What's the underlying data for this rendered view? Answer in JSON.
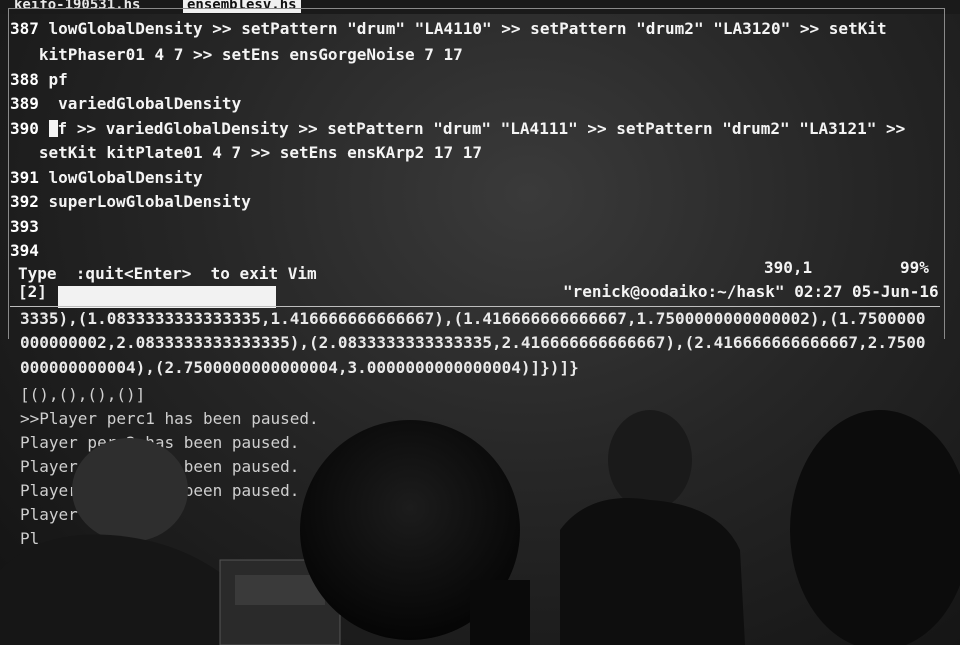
{
  "tabs": [
    {
      "label": "keifo-190531.hs"
    },
    {
      "label": "ensemblesv.hs"
    }
  ],
  "vim": {
    "lines": [
      {
        "num": "387",
        "text": " lowGlobalDensity >> setPattern \"drum\" \"LA4110\" >> setPattern \"drum2\" \"LA3120\" >> setKit"
      },
      {
        "num": "",
        "text": "   kitPhaser01 4 7 >> setEns ensGorgeNoise 7 17"
      },
      {
        "num": "388",
        "text": " pf"
      },
      {
        "num": "389",
        "text": "  variedGlobalDensity"
      },
      {
        "num": "390",
        "text": "f >> variedGlobalDensity >> setPattern \"drum\" \"LA4111\" >> setPattern \"drum2\" \"LA3121\" >>"
      },
      {
        "num": "",
        "text": "   setKit kitPlate01 4 7 >> setEns ensKArp2 17 17"
      },
      {
        "num": "391",
        "text": " lowGlobalDensity"
      },
      {
        "num": "392",
        "text": " superLowGlobalDensity"
      },
      {
        "num": "393",
        "text": ""
      },
      {
        "num": "394",
        "text": ""
      }
    ],
    "message": "Type  :quit<Enter>  to exit Vim",
    "position": "390,1",
    "percent": "99%"
  },
  "tmux": {
    "window": "[2]",
    "right": "\"renick@oodaiko:~/hask\" 02:27 05-Jun-16"
  },
  "ghci": [
    "3335),(1.0833333333333335,1.416666666666667),(1.416666666666667,1.7500000000000002),(1.7500000",
    "000000002,2.0833333333333335),(2.0833333333333335,2.416666666666667),(2.416666666666667,2.7500",
    "000000000004),(2.7500000000000004,3.0000000000000004)]})]}",
    "[(),(),(),()]",
    ">>Player perc1 has been paused.",
    "Player perc2 has been paused.",
    "Player perc3 has been paused.",
    "Player perc4 has been paused.",
    "Player",
    "Pl"
  ]
}
